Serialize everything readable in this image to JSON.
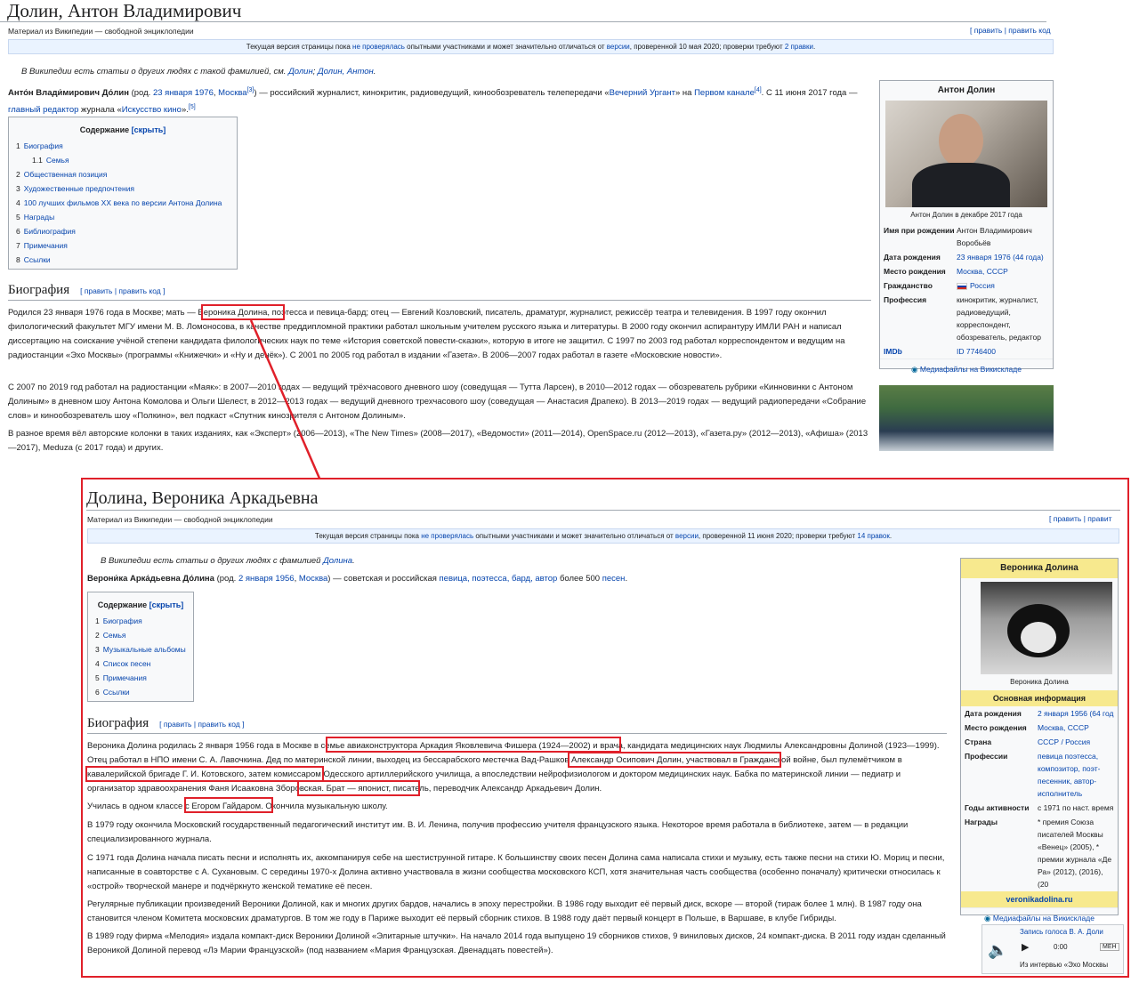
{
  "top": {
    "title": "Долин, Антон Владимирович",
    "subtitle": "Материал из Википедии — свободной энциклопедии",
    "edit_links": "[ править | править код",
    "flagged": {
      "pre": "Текущая версия страницы пока ",
      "link1": "не проверялась",
      "mid": " опытными участниками и может значительно отличаться от ",
      "link2": "версии",
      "post": ", проверенной 10 мая 2020; проверки требуют ",
      "link3": "2 правки",
      "end": "."
    },
    "hatnote_pre": "В Википедии есть статьи о других людях с такой фамилией, см. ",
    "hatnote_link1": "Долин",
    "hatnote_link2": "Долин, Антон",
    "hatnote_end": ".",
    "intro": {
      "name": "Анто́н Влади́мирович До́лин",
      "t1": " (род. ",
      "date": "23 января 1976",
      "comma": ", ",
      "city": "Москва",
      "t2": ") — российский журналист, кинокритик, радиоведущий, кинообозреватель телепередачи «",
      "show": "Вечерний Ургант",
      "t3": "» на ",
      "channel": "Первом канале",
      "t4": ". С 11 июня 2017 года — ",
      "role": "главный редактор",
      "t5": " журнала «",
      "mag": "Искусство кино",
      "t6": "»."
    },
    "toc": {
      "title": "Содержание",
      "toggle": " [скрыть]",
      "items": [
        {
          "num": "1",
          "label": "Биография"
        },
        {
          "num": "1.1",
          "label": "Семья"
        },
        {
          "num": "2",
          "label": "Общественная позиция"
        },
        {
          "num": "3",
          "label": "Художественные предпочтения"
        },
        {
          "num": "4",
          "label": "100 лучших фильмов XX века по версии Антона Долина"
        },
        {
          "num": "5",
          "label": "Награды"
        },
        {
          "num": "6",
          "label": "Библиография"
        },
        {
          "num": "7",
          "label": "Примечания"
        },
        {
          "num": "8",
          "label": "Ссылки"
        }
      ]
    },
    "bio_heading": "Биография",
    "bio_edit": "[ править | править код ]",
    "bio_p1": "Родился 23 января 1976 года в Москве; мать — Вероника Долина, поэтесса и певица-бард; отец — Евгений Козловский, писатель, драматург, журналист, режиссёр театра и телевидения. В 1997 году окончил филологический факультет МГУ имени М. В. Ломоносова, в качестве преддипломной практики работал школьным учителем русского языка и литературы. В 2000 году окончил аспирантуру ИМЛИ РАН и написал диссертацию на соискание учёной степени кандидата филологических наук по теме «История советской повести-сказки», которую в итоге не защитил. С 1997 по 2003 год работал корреспондентом и ведущим на радиостанции «Эхо Москвы» (программы «Книжечки» и «Ну и денёк»). С 2001 по 2005 год работал в издании «Газета». В 2006—2007 годах работал в газете «Московские новости».",
    "bio_p2": "С 2007 по 2019 год работал на радиостанции «Маяк»: в 2007—2010 годах — ведущий трёхчасового дневного шоу (соведущая — Тутта Ларсен), в 2010—2012 годах — обозреватель рубрики «Кинновинки с Антоном Долиным» в дневном шоу Антона Комолова и Ольги Шелест, в 2012—2013 годах — ведущий дневного трехчасового шоу (соведущая — Анастасия Драпеко). В 2013—2019 годах — ведущий радиопередачи «Собрание слов» и кинообозреватель шоу «Полкино», вел подкаст «Спутник кинозрителя с Антоном Долиным».",
    "bio_p3": "В разное время вёл авторские колонки в таких изданиях, как «Эксперт» (2006—2013), «The New Times» (2008—2017), «Ведомости» (2011—2014), OpenSpace.ru (2012—2013), «Газета.ру» (2012—2013), «Афиша» (2013—2017), Meduza (с 2017 года) и других.",
    "infobox": {
      "title": "Антон Долин",
      "caption": "Антон Долин в декабре 2017 года",
      "rows": [
        {
          "label": "Имя при рождении",
          "value": "Антон Владимирович Воробьёв"
        },
        {
          "label": "Дата рождения",
          "value": "23 января 1976 (44 года)"
        },
        {
          "label": "Место рождения",
          "value": "Москва, СССР"
        },
        {
          "label": "Гражданство",
          "value": "Россия"
        },
        {
          "label": "Профессия",
          "value": "кинокритик, журналист, радиоведущий, корреспондент, обозреватель, редактор"
        },
        {
          "label": "IMDb",
          "value": "ID 7746400"
        }
      ],
      "commons": "Медиафайлы на Викискладе"
    }
  },
  "bottom": {
    "title": "Долина, Вероника Аркадьевна",
    "subtitle": "Материал из Википедии — свободной энциклопедии",
    "edit_links": "[ править | правит",
    "flagged": {
      "pre": "Текущая версия страницы пока ",
      "link1": "не проверялась",
      "mid": " опытными участниками и может значительно отличаться от ",
      "link2": "версии",
      "post": ", проверенной 11 июня 2020; проверки требуют ",
      "link3": "14 правок",
      "end": "."
    },
    "hatnote_pre": "В Википедии есть статьи о других людях с фамилией ",
    "hatnote_link": "Долина",
    "hatnote_end": ".",
    "intro": {
      "name": "Верони́ка Арка́дьевна До́лина",
      "t1": " (род. ",
      "date": "2 января 1956",
      "comma": ", ",
      "city": "Москва",
      "t2": ") — советская и российская ",
      "links": "певица, поэтесса, бард, автор",
      "t3": " более 500 ",
      "songs": "песен",
      "t4": "."
    },
    "toc": {
      "title": "Содержание",
      "toggle": " [скрыть]",
      "items": [
        {
          "num": "1",
          "label": "Биография"
        },
        {
          "num": "2",
          "label": "Семья"
        },
        {
          "num": "3",
          "label": "Музыкальные альбомы"
        },
        {
          "num": "4",
          "label": "Список песен"
        },
        {
          "num": "5",
          "label": "Примечания"
        },
        {
          "num": "6",
          "label": "Ссылки"
        }
      ]
    },
    "bio_heading": "Биография",
    "bio_edit": "[ править | править код ]",
    "bio_p1": "Вероника Долина родилась 2 января 1956 года в Москве в семье авиаконструктора Аркадия Яковлевича Фишера (1924—2002) и врача, кандидата медицинских наук Людмилы Александровны Долиной (1923—1999). Отец работал в НПО имени С. А. Лавочкина. Дед по материнской линии, выходец из бессарабского местечка Вад-Рашков Александр Осипович Долин, участвовал в Гражданской войне, был пулемётчиком в кавалерийской бригаде Г. И. Котовского, затем комиссаром Одесского артиллерийского училища, а впоследствии нейрофизиологом и доктором медицинских наук. Бабка по материнской линии — педиатр и организатор здравоохранения Фаня Исааковна Зборовская. Брат — японист, писатель, переводчик Александр Аркадьевич Долин.",
    "bio_p2": "Училась в одном классе с Егором Гайдаром. Окончила музыкальную школу.",
    "bio_p3": "В 1979 году окончила Московский государственный педагогический институт им. В. И. Ленина, получив профессию учителя французского языка. Некоторое время работала в библиотеке, затем — в редакции специализированного журнала.",
    "bio_p4": "С 1971 года Долина начала писать песни и исполнять их, аккомпанируя себе на шестиструнной гитаре. К большинству своих песен Долина сама написала стихи и музыку, есть также песни на стихи Ю. Мориц и песни, написанные в соавторстве с А. Сухановым. С середины 1970-х Долина активно участвовала в жизни сообщества московского КСП, хотя значительная часть сообщества (особенно поначалу) критически относилась к «острой» творческой манере и подчёркнуто женской тематике её песен.",
    "bio_p5": "Регулярные публикации произведений Вероники Долиной, как и многих других бардов, начались в эпоху перестройки. В 1986 году выходит её первый диск, вскоре — второй (тираж более 1 млн). В 1987 году она становится членом Комитета московских драматургов. В том же году в Париже выходит её первый сборник стихов. В 1988 году даёт первый концерт в Польше, в Варшаве, в клубе Гибриды.",
    "bio_p6": "В 1989 году фирма «Мелодия» издала компакт-диск Вероники Долиной «Элитарные штучки». На начало 2014 года выпущено 19 сборников стихов, 9 виниловых дисков, 24 компакт-диска. В 2011 году издан сделанный Вероникой Долиной перевод «Лэ Марии Французской» (под названием «Мария Французская. Двенадцать повестей»).",
    "infobox": {
      "title": "Вероника Долина",
      "caption": "Вероника Долина",
      "section": "Основная информация",
      "rows": [
        {
          "label": "Дата рождения",
          "value": "2 января 1956 (64 год"
        },
        {
          "label": "Место рождения",
          "value": "Москва, СССР"
        },
        {
          "label": "Страна",
          "value": "СССР / Россия"
        },
        {
          "label": "Профессии",
          "value": "певица поэтесса, композитор, поэт-песенник, автор-исполнитель"
        },
        {
          "label": "Годы активности",
          "value": "с 1971 по наст. время"
        },
        {
          "label": "Награды",
          "value": "* премия Союза писателей Москвы «Венец» (2005), * премии журнала «Де Ра» (2012), (2016), (20"
        }
      ],
      "site": "veronikadolina.ru",
      "commons": "Медиафайлы на Викискладе",
      "audio_title": "Запись голоса В. А. Доли",
      "audio_time": "0:00",
      "audio_menu": "МЕН",
      "audio_from": "Из интервью «Эхо Москвы"
    }
  },
  "colors": {
    "link": "#0645ad",
    "highlight": "#e0202a",
    "infobox_header": "#f7e98e"
  }
}
